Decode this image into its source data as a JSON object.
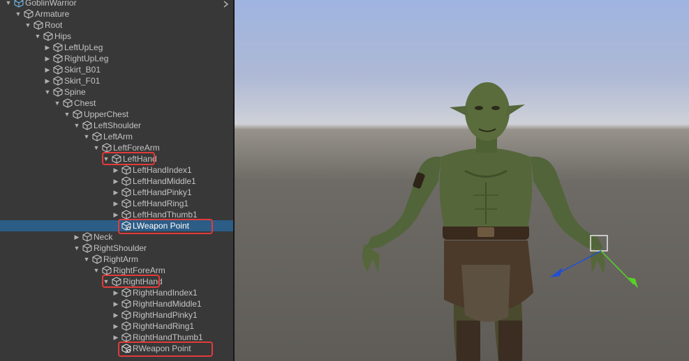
{
  "hierarchy": {
    "root": "GoblinWarrior",
    "items": [
      {
        "label": "GoblinWarrior",
        "depth": 0,
        "expanded": true,
        "root": true
      },
      {
        "label": "Armature",
        "depth": 1,
        "expanded": true
      },
      {
        "label": "Root",
        "depth": 2,
        "expanded": true
      },
      {
        "label": "Hips",
        "depth": 3,
        "expanded": true
      },
      {
        "label": "LeftUpLeg",
        "depth": 4,
        "expanded": false
      },
      {
        "label": "RightUpLeg",
        "depth": 4,
        "expanded": false
      },
      {
        "label": "Skirt_B01",
        "depth": 4,
        "expanded": false
      },
      {
        "label": "Skirt_F01",
        "depth": 4,
        "expanded": false
      },
      {
        "label": "Spine",
        "depth": 4,
        "expanded": true
      },
      {
        "label": "Chest",
        "depth": 5,
        "expanded": true
      },
      {
        "label": "UpperChest",
        "depth": 6,
        "expanded": true
      },
      {
        "label": "LeftShoulder",
        "depth": 7,
        "expanded": true
      },
      {
        "label": "LeftArm",
        "depth": 8,
        "expanded": true
      },
      {
        "label": "LeftForeArm",
        "depth": 9,
        "expanded": true
      },
      {
        "label": "LeftHand",
        "depth": 10,
        "expanded": true,
        "highlighted": true
      },
      {
        "label": "LeftHandIndex1",
        "depth": 11,
        "expanded": false
      },
      {
        "label": "LeftHandMiddle1",
        "depth": 11,
        "expanded": false
      },
      {
        "label": "LeftHandPinky1",
        "depth": 11,
        "expanded": false
      },
      {
        "label": "LeftHandRing1",
        "depth": 11,
        "expanded": false
      },
      {
        "label": "LeftHandThumb1",
        "depth": 11,
        "expanded": false
      },
      {
        "label": "LWeapon Point",
        "depth": 11,
        "leaf": true,
        "selected": true,
        "highlighted": true
      },
      {
        "label": "Neck",
        "depth": 7,
        "expanded": false
      },
      {
        "label": "RightShoulder",
        "depth": 7,
        "expanded": true
      },
      {
        "label": "RightArm",
        "depth": 8,
        "expanded": true
      },
      {
        "label": "RightForeArm",
        "depth": 9,
        "expanded": true
      },
      {
        "label": "RightHand",
        "depth": 10,
        "expanded": true,
        "highlighted": true
      },
      {
        "label": "RightHandIndex1",
        "depth": 11,
        "expanded": false
      },
      {
        "label": "RightHandMiddle1",
        "depth": 11,
        "expanded": false
      },
      {
        "label": "RightHandPinky1",
        "depth": 11,
        "expanded": false
      },
      {
        "label": "RightHandRing1",
        "depth": 11,
        "expanded": false
      },
      {
        "label": "RightHandThumb1",
        "depth": 11,
        "expanded": false
      },
      {
        "label": "RWeapon Point",
        "depth": 11,
        "leaf": true,
        "highlighted": true
      }
    ]
  },
  "colors": {
    "panel_bg": "#383838",
    "selection": "#2c5d87",
    "highlight_box": "#e23b3b",
    "text": "#c4c4c4",
    "gizmo_x": "#1f4fd6",
    "gizmo_y": "#56d424"
  },
  "scene": {
    "selected_object": "LWeapon Point",
    "gizmo": "move-tool-gizmo"
  }
}
